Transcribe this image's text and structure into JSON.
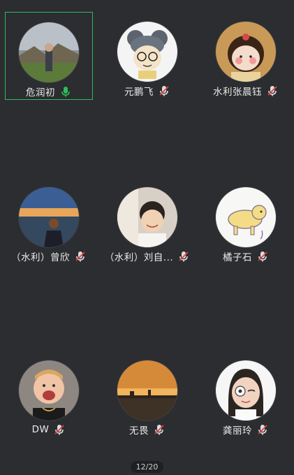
{
  "grid": {
    "participants": [
      {
        "name": "危润初",
        "mic": "on",
        "speaking": true,
        "avatar": "photo-person-in-field"
      },
      {
        "name": "元鹏飞",
        "mic": "muted",
        "speaking": false,
        "avatar": "cartoon-mouse-hat"
      },
      {
        "name": "水利张晨钰",
        "mic": "muted",
        "speaking": false,
        "avatar": "cartoon-girl-blush"
      },
      {
        "name": "（水利）曾欣",
        "mic": "muted",
        "speaking": false,
        "avatar": "photo-sunset-girl"
      },
      {
        "name": "（水利）刘自...",
        "mic": "muted",
        "speaking": false,
        "avatar": "photo-boy-grin"
      },
      {
        "name": "橘子石",
        "mic": "muted",
        "speaking": false,
        "avatar": "cartoon-puppy"
      },
      {
        "name": "DW",
        "mic": "muted",
        "speaking": false,
        "avatar": "photo-laughing-boy"
      },
      {
        "name": "无畏",
        "mic": "muted",
        "speaking": false,
        "avatar": "photo-sunset-lake"
      },
      {
        "name": "龚丽玲",
        "mic": "muted",
        "speaking": false,
        "avatar": "memoji-girl"
      }
    ]
  },
  "page_indicator": "12/20",
  "colors": {
    "background": "#2b2d30",
    "speaking_border": "#2dbd59",
    "mic_on": "#2dbd59",
    "mic_muted_slash": "#e04040"
  }
}
